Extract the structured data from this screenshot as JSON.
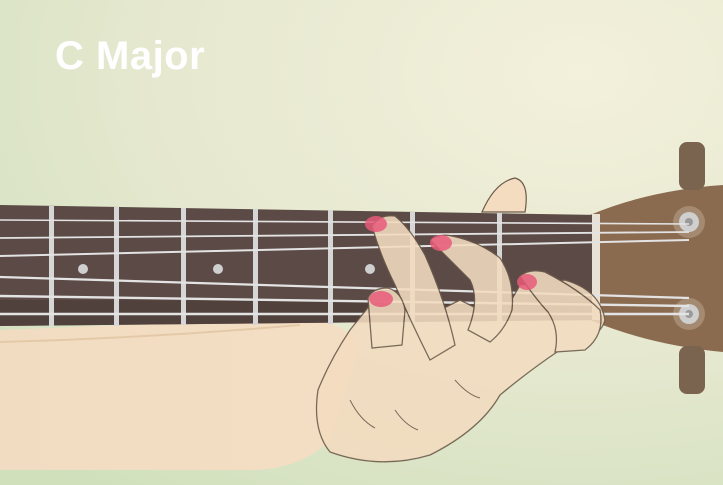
{
  "title": "C Major",
  "colors": {
    "background_light": "#eeeed8",
    "background_mid": "#d9e3c7",
    "background_green": "#c8dbb5",
    "fretboard": "#5b4a45",
    "fretboard_dark": "#463835",
    "frets": "#d6d6d6",
    "strings": "#e3e3e3",
    "headstock": "#8a6b50",
    "tuner": "#7a6450",
    "tuner_post": "#cfcfcf",
    "skin": "#f3dcc0",
    "skin_shadow": "#e7c8a6",
    "skin_outline": "#6b5a4a",
    "fingertip_marker": "#e85a7a",
    "fret_dots": "#cfcfcf"
  },
  "icons": [
    "guitar-neck-illustration",
    "hand-illustration",
    "tuning-peg-icon"
  ],
  "fingered_notes": 3
}
